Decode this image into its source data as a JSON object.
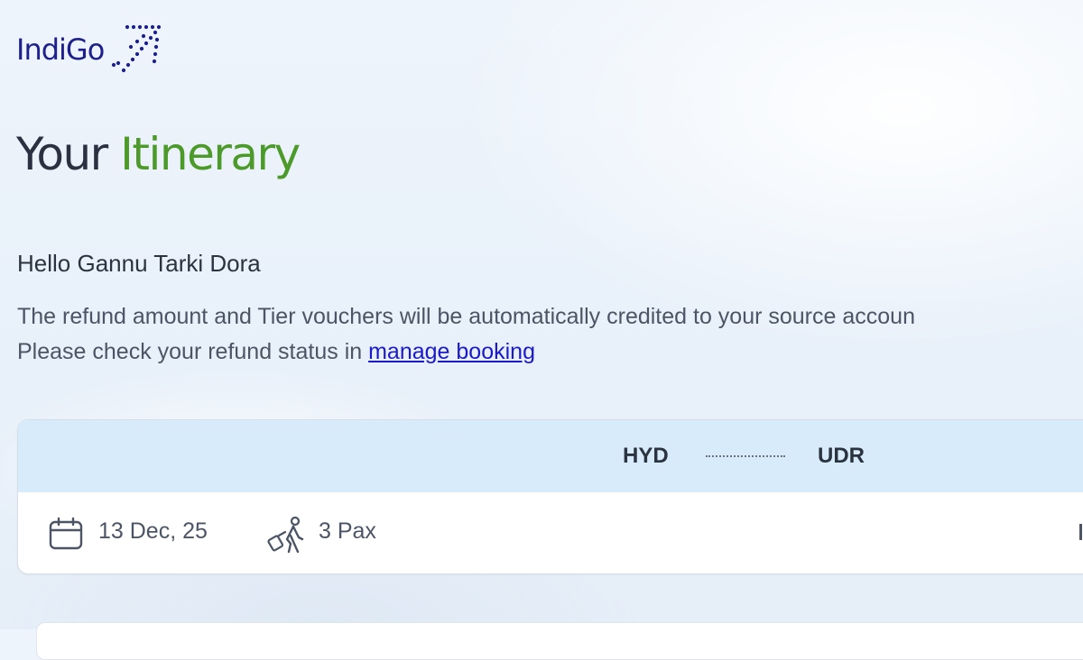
{
  "brand": {
    "name": "IndiGo",
    "logo_icon": "indigo-plane-dots-icon",
    "color": "#1c1f8c"
  },
  "page": {
    "title_part1": "Your",
    "title_part2": "Itinerary",
    "accent_color": "#4c9a2a"
  },
  "greeting": "Hello Gannu Tarki Dora",
  "message": {
    "line1": "The refund amount and Tier vouchers will be automatically credited to your source accoun",
    "line2_prefix": "Please check your refund status in ",
    "link_text": "manage booking"
  },
  "flight": {
    "origin": "HYD",
    "destination": "UDR",
    "date": "13 Dec, 25",
    "date_icon": "calendar-icon",
    "passengers": "3 Pax",
    "passenger_icon": "traveller-luggage-icon"
  }
}
